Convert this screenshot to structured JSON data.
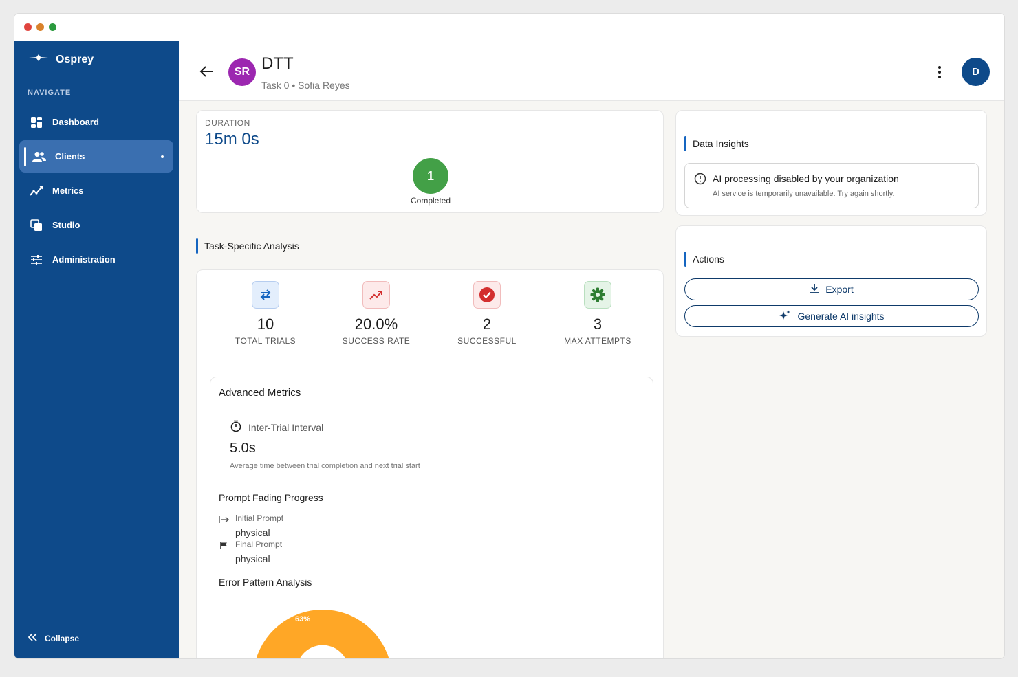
{
  "app": {
    "name": "Osprey"
  },
  "sidebar": {
    "section_label": "NAVIGATE",
    "items": [
      {
        "label": "Dashboard",
        "icon": "dashboard-icon"
      },
      {
        "label": "Clients",
        "icon": "users-icon",
        "active": true
      },
      {
        "label": "Metrics",
        "icon": "metrics-icon"
      },
      {
        "label": "Studio",
        "icon": "studio-icon"
      },
      {
        "label": "Administration",
        "icon": "sliders-icon"
      }
    ],
    "collapse_label": "Collapse"
  },
  "header": {
    "avatar_initials": "SR",
    "title": "DTT",
    "subtitle": "Task 0 • Sofia Reyes",
    "user_initial": "D"
  },
  "summary": {
    "duration_label": "DURATION",
    "duration_value": "15m 0s",
    "completed_count": "1",
    "completed_label": "Completed"
  },
  "analysis": {
    "title": "Task-Specific Analysis",
    "stats": [
      {
        "value": "10",
        "label": "TOTAL TRIALS",
        "icon": "repeat-icon"
      },
      {
        "value": "20.0%",
        "label": "SUCCESS RATE",
        "icon": "trending-up-icon"
      },
      {
        "value": "2",
        "label": "SUCCESSFUL",
        "icon": "check-circle-icon"
      },
      {
        "value": "3",
        "label": "MAX ATTEMPTS",
        "icon": "gear-icon"
      }
    ]
  },
  "advanced": {
    "title": "Advanced Metrics",
    "iti_label": "Inter-Trial Interval",
    "iti_value": "5.0s",
    "iti_desc": "Average time between trial completion and next trial start",
    "prompt_fading_title": "Prompt Fading Progress",
    "initial_prompt_label": "Initial Prompt",
    "initial_prompt_value": "physical",
    "final_prompt_label": "Final Prompt",
    "final_prompt_value": "physical",
    "error_title": "Error Pattern Analysis",
    "pie_label": "63%"
  },
  "colors": {
    "primary": "#0e4a8a",
    "success": "#43a047",
    "pie": "#ffa726",
    "accent": "#1565c0"
  },
  "insights": {
    "title": "Data Insights",
    "alert_title": "AI processing disabled by your organization",
    "alert_desc": "AI service is temporarily unavailable. Try again shortly."
  },
  "actions": {
    "title": "Actions",
    "export_label": "Export",
    "generate_label": "Generate AI insights"
  }
}
